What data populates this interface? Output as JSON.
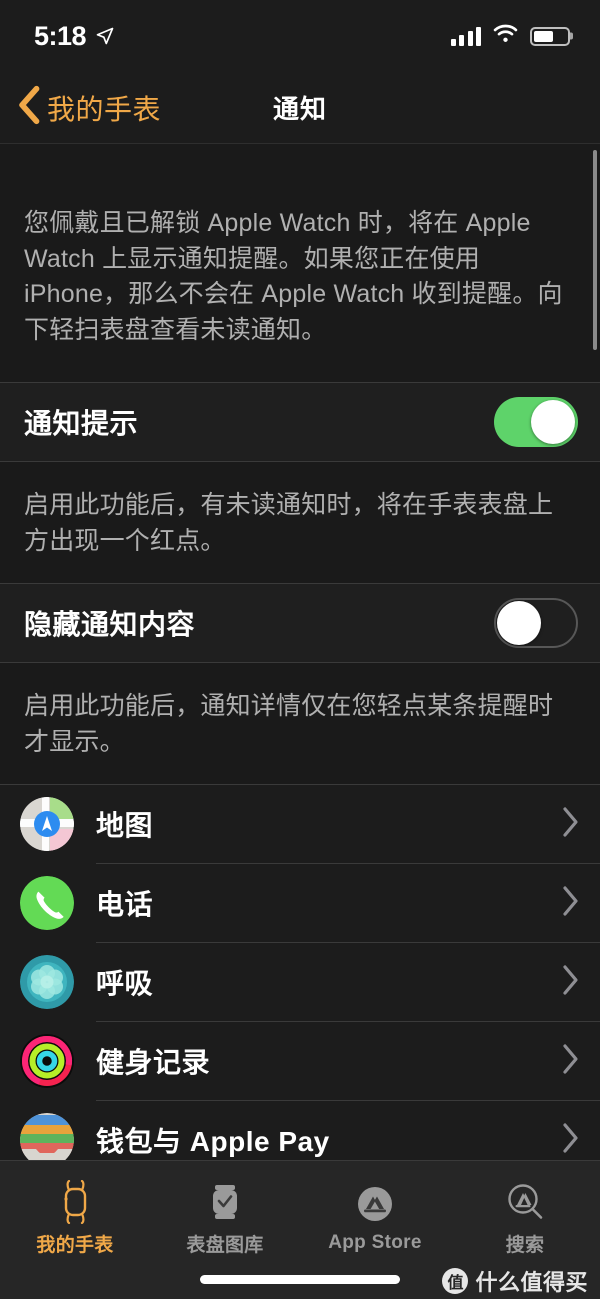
{
  "status_bar": {
    "time": "5:18",
    "location_icon": "location-arrow-icon",
    "signal_icon": "cellular-signal-icon",
    "wifi_icon": "wifi-icon",
    "battery_icon": "battery-icon",
    "battery_level_percent": 60
  },
  "nav": {
    "back_label": "我的手表",
    "back_icon": "chevron-left-icon",
    "title": "通知",
    "accent_color": "#F0A848"
  },
  "sections": {
    "intro_footnote": "您佩戴且已解锁 Apple Watch 时，将在 Apple Watch 上显示通知提醒。如果您正在使用 iPhone，那么不会在 Apple Watch 收到提醒。向下轻扫表盘查看未读通知。",
    "notification_indicator": {
      "label": "通知提示",
      "state": "on",
      "footnote": "启用此功能后，有未读通知时，将在手表表盘上方出现一个红点。"
    },
    "hide_notification_content": {
      "label": "隐藏通知内容",
      "state": "off",
      "footnote": "启用此功能后，通知详情仅在您轻点某条提醒时才显示。"
    }
  },
  "app_list": [
    {
      "name": "地图",
      "icon": "maps-icon",
      "chevron": "chevron-right-icon"
    },
    {
      "name": "电话",
      "icon": "phone-icon",
      "chevron": "chevron-right-icon"
    },
    {
      "name": "呼吸",
      "icon": "breathe-icon",
      "chevron": "chevron-right-icon"
    },
    {
      "name": "健身记录",
      "icon": "activity-rings-icon",
      "chevron": "chevron-right-icon"
    },
    {
      "name": "钱包与 Apple Pay",
      "icon": "wallet-icon",
      "chevron": "chevron-right-icon"
    },
    {
      "name": "",
      "icon": "partially-visible-app-icon",
      "chevron": "chevron-right-icon"
    }
  ],
  "tab_bar": {
    "active_color": "#F0A848",
    "inactive_color": "#9A9A9A",
    "tabs": [
      {
        "label": "我的手表",
        "icon": "watch-icon",
        "active": true
      },
      {
        "label": "表盘图库",
        "icon": "watch-face-gallery-icon",
        "active": false
      },
      {
        "label": "App Store",
        "icon": "app-store-icon",
        "active": false
      },
      {
        "label": "搜索",
        "icon": "search-icon",
        "active": false
      }
    ]
  },
  "watermark": {
    "logo_text": "值",
    "text": "什么值得买"
  },
  "toggle_colors": {
    "on_track": "#5ED36A",
    "off_track_border": "#575757",
    "knob": "#FFFFFF"
  }
}
